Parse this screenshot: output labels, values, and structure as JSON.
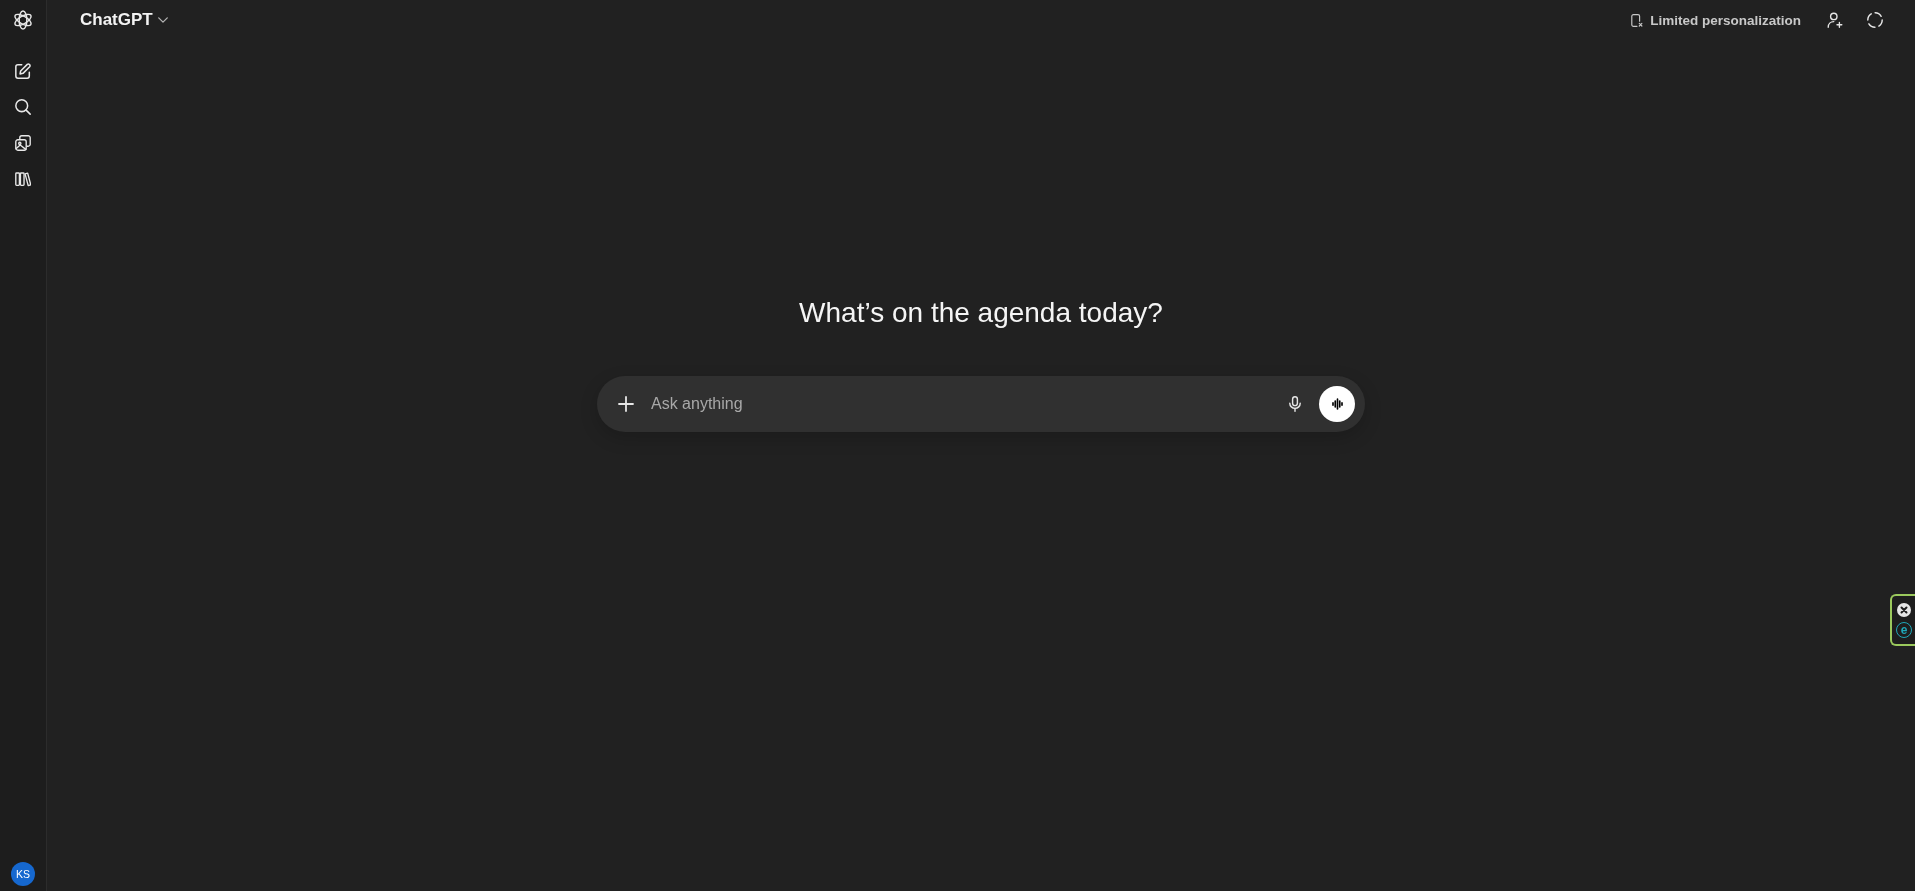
{
  "sidebar": {
    "avatar": {
      "initials": "KS"
    }
  },
  "header": {
    "model_menu": {
      "label": "ChatGPT"
    },
    "personalization": {
      "label": "Limited personalization"
    }
  },
  "main": {
    "heading": "What’s on the agenda today?",
    "composer": {
      "placeholder": "Ask anything"
    }
  },
  "extension_widget": {
    "logo_letter": "e"
  }
}
